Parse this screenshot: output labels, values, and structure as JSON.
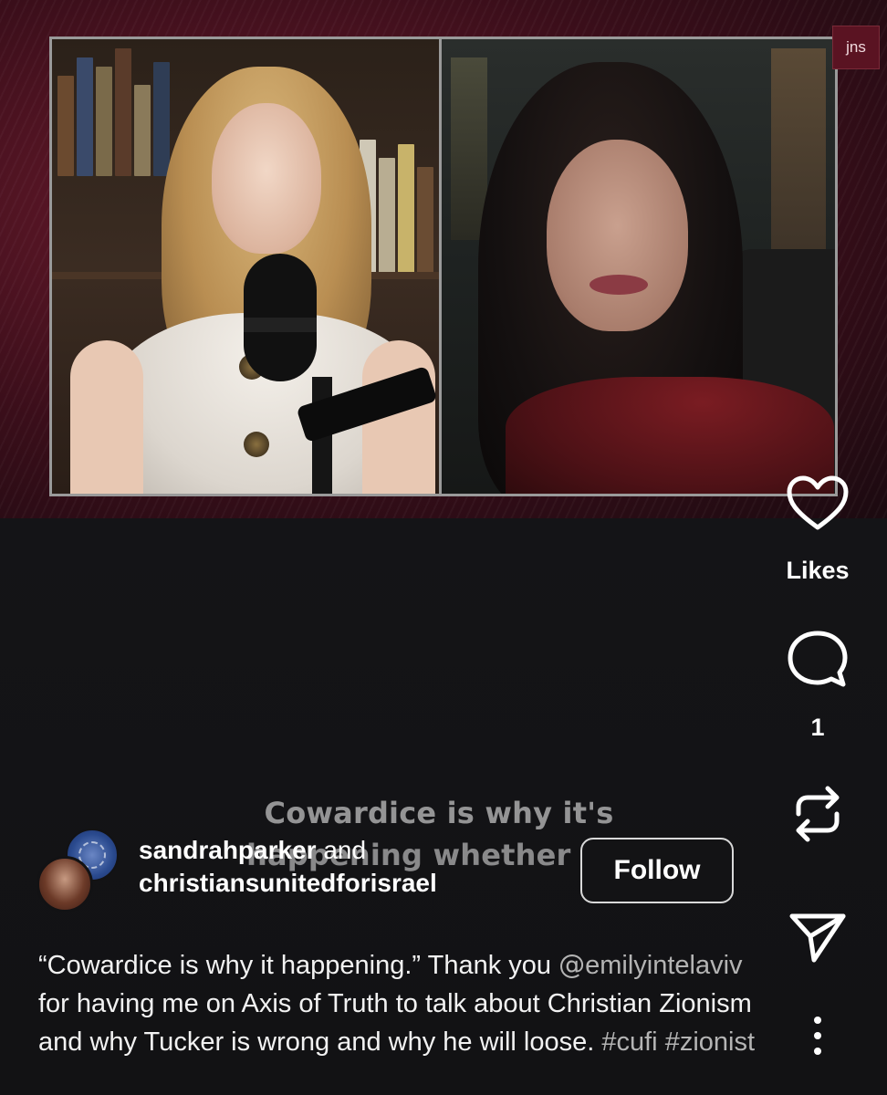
{
  "video": {
    "watermark": "jns",
    "overlay_caption_line1": "Cowardice is why it's",
    "overlay_caption_line2": "happening whether"
  },
  "actions": {
    "like_label": "Likes",
    "comment_count": "1"
  },
  "account": {
    "user1": "sandrahparker",
    "joiner": " and",
    "user2": "christiansunitedforisrael",
    "follow_label": "Follow"
  },
  "caption": {
    "text_before_mention": "“Cowardice is why it happening.” Thank you ",
    "mention_icon": "@",
    "mention": "emilyintelaviv",
    "text_after_mention": " for having me on Axis of Truth to talk about Christian Zionism and why Tucker is wrong and why he will loose. ",
    "hashtag1": "#cufi",
    "hashtag2": "#zionist"
  },
  "icons": {
    "like": "heart-icon",
    "comment": "comment-bubble-icon",
    "repost": "repost-icon",
    "share": "send-icon",
    "more": "more-vertical-icon"
  }
}
